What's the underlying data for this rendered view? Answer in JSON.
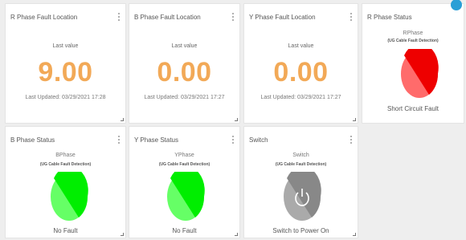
{
  "widgets": [
    {
      "title": "R Phase Fault Location",
      "sub": "Last value",
      "value": "9.00",
      "updated": "Last Updated: 03/29/2021 17:28"
    },
    {
      "title": "B Phase Fault Location",
      "sub": "Last value",
      "value": "0.00",
      "updated": "Last Updated: 03/29/2021 17:27"
    },
    {
      "title": "Y Phase Fault Location",
      "sub": "Last value",
      "value": "0.00",
      "updated": "Last Updated: 03/29/2021 17:27"
    }
  ],
  "status_widgets": [
    {
      "title": "R Phase Status",
      "name": "RPhase",
      "system": "(UG Cable Fault Detection)",
      "status": "Short Circuit Fault",
      "color_light": "#ff6b6b",
      "color_dark": "#ee0000"
    },
    {
      "title": "B Phase Status",
      "name": "BPhase",
      "system": "(UG Cable Fault Detection)",
      "status": "No Fault",
      "color_light": "#66ff66",
      "color_dark": "#00ee00"
    },
    {
      "title": "Y Phase Status",
      "name": "YPhase",
      "system": "(UG Cable Fault Detection)",
      "status": "No Fault",
      "color_light": "#66ff66",
      "color_dark": "#00ee00"
    }
  ],
  "switch_widget": {
    "title": "Switch",
    "name": "Switch",
    "system": "(UG Cable Fault Detection)",
    "status": "Switch to Power On",
    "color_light": "#aaaaaa",
    "color_dark": "#888888"
  },
  "colors": {
    "value": "#f2a957",
    "background": "#eeeeee",
    "badge": "#2a9fd6"
  },
  "icons": [
    "kebab-menu-icon",
    "resize-handle-icon",
    "power-icon"
  ]
}
